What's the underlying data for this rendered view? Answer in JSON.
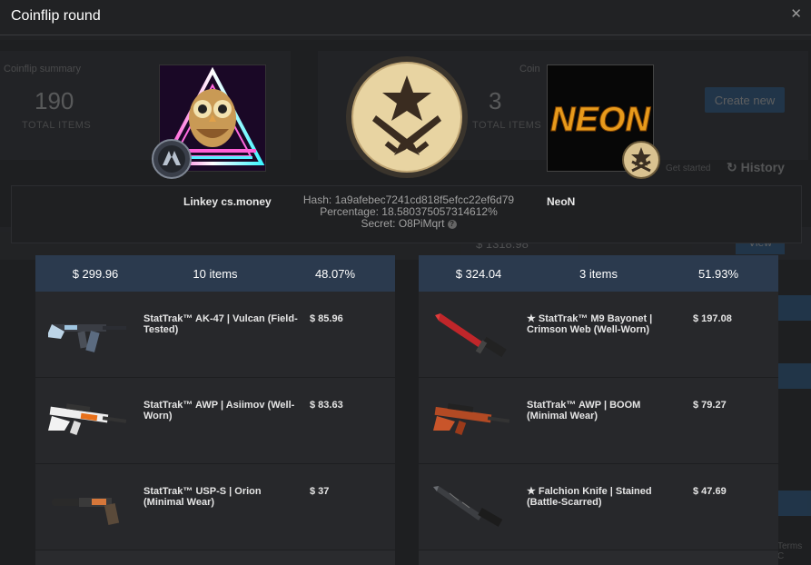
{
  "modal": {
    "title": "Coinflip round",
    "close_icon": "✕"
  },
  "background": {
    "summary_title_left": "Coinflip summary",
    "summary_title_right": "Coin",
    "total_items_count": "190",
    "total_items_label": "TOTAL ITEMS",
    "total_items_count_right": "3",
    "total_items_label_right": "TOTAL ITEMS",
    "create_button": "Create new",
    "get_started": "Get started",
    "history": "History",
    "row_value": "$ 1318.98",
    "view_button": "View",
    "terms": "Terms C"
  },
  "round": {
    "player_left": {
      "name": "Linkey cs.money"
    },
    "player_right": {
      "name": "NeoN",
      "avatar_text": "NEON"
    },
    "hash_text": "Hash: 1a9afebec7241cd818f5efcc22ef6d79",
    "percentage_text": "Percentage: 18.580375057314612%",
    "secret_text": "Secret: O8PiMqrt",
    "help_icon": "?"
  },
  "sides": {
    "left": {
      "total": "$ 299.96",
      "count": "10 items",
      "chance": "48.07%",
      "items": [
        {
          "name": "StatTrak™ AK-47 | Vulcan (Field-Tested)",
          "price": "$ 85.96",
          "icon": "ak47-icon"
        },
        {
          "name": "StatTrak™ AWP | Asiimov (Well-Worn)",
          "price": "$ 83.63",
          "icon": "awp-asiimov-icon"
        },
        {
          "name": "StatTrak™ USP-S | Orion (Minimal Wear)",
          "price": "$ 37",
          "icon": "usp-s-icon"
        }
      ]
    },
    "right": {
      "total": "$ 324.04",
      "count": "3 items",
      "chance": "51.93%",
      "items": [
        {
          "name": "★ StatTrak™ M9 Bayonet | Crimson Web (Well-Worn)",
          "price": "$ 197.08",
          "icon": "m9-bayonet-icon"
        },
        {
          "name": "StatTrak™ AWP | BOOM (Minimal Wear)",
          "price": "$ 79.27",
          "icon": "awp-boom-icon"
        },
        {
          "name": "★ Falchion Knife | Stained (Battle-Scarred)",
          "price": "$ 47.69",
          "icon": "falchion-knife-icon"
        }
      ]
    }
  },
  "colors": {
    "side_header": "#2b3a4e",
    "accent_blue": "#2a6fb0",
    "coin_gold": "#e8d4a2"
  }
}
